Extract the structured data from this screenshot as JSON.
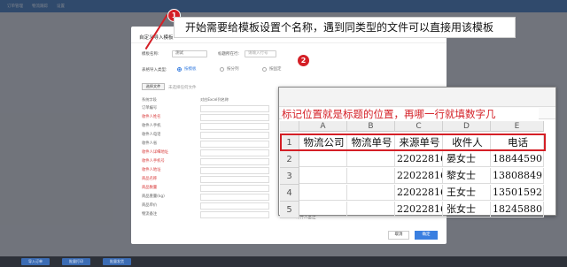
{
  "app": {
    "top_items": [
      "订单管理",
      "物流跟踪",
      "设置"
    ]
  },
  "dialog": {
    "title": "自定义导入模板",
    "close": "×",
    "template_name_label": "模板名称:",
    "template_name_value": "测试",
    "title_row_label": "标题所在行:",
    "title_row_placeholder": "请输入行号",
    "import_type_label": "表格导入类型:",
    "import_options": [
      "按模板",
      "按分列",
      "按固定"
    ],
    "upload_button": "选择文件",
    "upload_hint": "未选择任何文件",
    "mapping_header_left": "系统字段",
    "mapping_header_right": "对应Excel列名称",
    "fields": [
      {
        "label": "订单编号",
        "required": false
      },
      {
        "label": "收件人姓名",
        "required": true
      },
      {
        "label": "收件人手机",
        "required": false
      },
      {
        "label": "收件人电话",
        "required": false
      },
      {
        "label": "收件人省",
        "required": false
      },
      {
        "label": "收件人详细地址",
        "required": true
      },
      {
        "label": "收件人手机号",
        "required": true
      },
      {
        "label": "收件人地址",
        "required": true
      },
      {
        "label": "商品名称",
        "required": true
      },
      {
        "label": "商品数量",
        "required": true
      },
      {
        "label": "商品重量(kg)",
        "required": false
      },
      {
        "label": "商品单价",
        "required": false
      },
      {
        "label": "物流备注",
        "required": false
      }
    ],
    "extra_field_label": "寄件人备注",
    "cancel_label": "取消",
    "ok_label": "确定"
  },
  "callouts": {
    "badge1": "1",
    "text1": "开始需要给模板设置个名称，遇到同类型的文件可以直接用该模板",
    "badge2": "2",
    "text2": "标记位置就是标题的位置，再哪一行就填数字几"
  },
  "sheet": {
    "columns": [
      "A",
      "B",
      "C",
      "D",
      "E"
    ],
    "row_numbers": [
      "1",
      "2",
      "3",
      "4",
      "5"
    ],
    "header_row": [
      "物流公司",
      "物流单号",
      "来源单号",
      "收件人",
      "电话"
    ],
    "rows": [
      [
        "",
        "",
        "22022816",
        "晏女士",
        "18844590"
      ],
      [
        "",
        "",
        "22022816",
        "黎女士",
        "13808849"
      ],
      [
        "",
        "",
        "22022816",
        "王女士",
        "13501592"
      ],
      [
        "",
        "",
        "22022816",
        "张女士",
        "18245880"
      ]
    ]
  },
  "bottom": {
    "buttons": [
      "导入订单",
      "批量打印",
      "批量发货"
    ]
  },
  "colors": {
    "accent": "#3a7fe0",
    "callout_red": "#d41f26"
  }
}
